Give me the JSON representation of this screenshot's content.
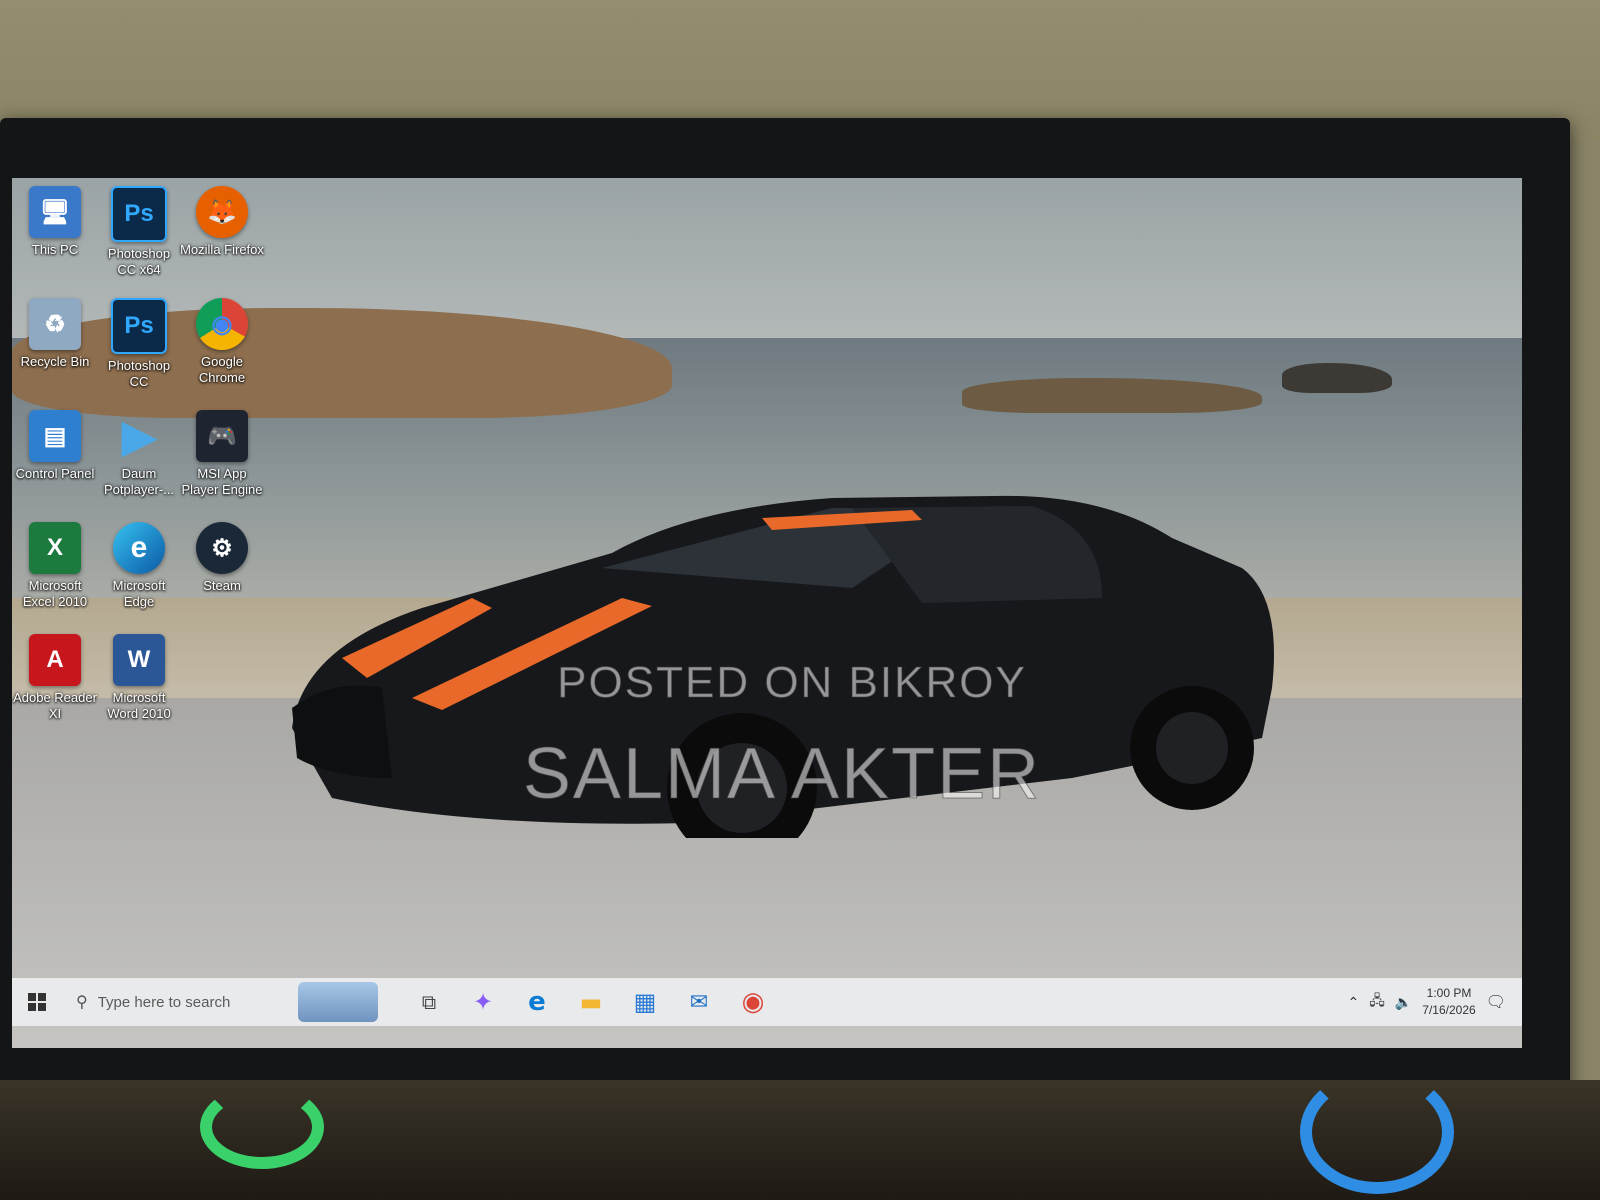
{
  "desktop_icons": [
    {
      "label": "This PC",
      "icon": "this-pc-icon",
      "color": "#3a78c9",
      "glyph": "🖥"
    },
    {
      "label": "Photoshop CC x64",
      "icon": "photoshop-icon",
      "color": "#0b2a4a",
      "glyph": "Ps"
    },
    {
      "label": "Mozilla Firefox",
      "icon": "firefox-icon",
      "color": "#e66000",
      "glyph": "🦊"
    },
    {
      "label": "Recycle Bin",
      "icon": "recycle-bin-icon",
      "color": "#8fa9c2",
      "glyph": "♻"
    },
    {
      "label": "Photoshop CC",
      "icon": "photoshop-icon",
      "color": "#0b2a4a",
      "glyph": "Ps"
    },
    {
      "label": "Google Chrome",
      "icon": "chrome-icon",
      "color": "#db4437",
      "glyph": "◉"
    },
    {
      "label": "Control Panel",
      "icon": "control-panel-icon",
      "color": "#2f7fd1",
      "glyph": "▤"
    },
    {
      "label": "Daum Potplayer-...",
      "icon": "potplayer-icon",
      "color": "#3a9ad9",
      "glyph": "▶"
    },
    {
      "label": "MSI App Player Engine",
      "icon": "msi-app-player-icon",
      "color": "#1f2530",
      "glyph": "🎮"
    },
    {
      "label": "Microsoft Excel 2010",
      "icon": "excel-icon",
      "color": "#1d7a3f",
      "glyph": "X"
    },
    {
      "label": "Microsoft Edge",
      "icon": "edge-icon",
      "color": "#0c7bd6",
      "glyph": "e"
    },
    {
      "label": "Steam",
      "icon": "steam-icon",
      "color": "#1b2838",
      "glyph": "⚙"
    },
    {
      "label": "Adobe Reader XI",
      "icon": "adobe-reader-icon",
      "color": "#c8161d",
      "glyph": "A"
    },
    {
      "label": "Microsoft Word 2010",
      "icon": "word-icon",
      "color": "#2b5797",
      "glyph": "W"
    }
  ],
  "watermark": {
    "line1": "POSTED ON BIKROY",
    "line2": "SALMA AKTER"
  },
  "taskbar": {
    "search_placeholder": "Type here to search",
    "apps": [
      {
        "icon": "task-view-icon",
        "glyph": "⧉",
        "color": "#444444"
      },
      {
        "icon": "copilot-icon",
        "glyph": "✦",
        "color": "#8a5cf6"
      },
      {
        "icon": "edge-icon",
        "glyph": "e",
        "color": "#0c7bd6"
      },
      {
        "icon": "file-explorer-icon",
        "glyph": "▬",
        "color": "#f2b632"
      },
      {
        "icon": "microsoft-store-icon",
        "glyph": "▦",
        "color": "#2a7ad5"
      },
      {
        "icon": "outlook-icon",
        "glyph": "✉",
        "color": "#1f6fc5"
      },
      {
        "icon": "chrome-icon",
        "glyph": "◉",
        "color": "#db4437"
      }
    ],
    "time": "1:00 PM",
    "date": "7/16/2026"
  }
}
